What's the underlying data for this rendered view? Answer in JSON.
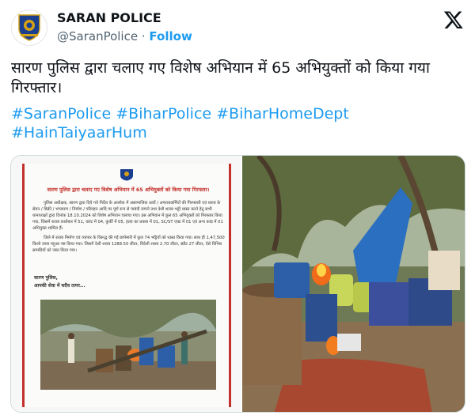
{
  "header": {
    "account_name": "SARAN POLICE",
    "handle": "@SaranPolice",
    "separator": "·",
    "follow_label": "Follow",
    "logo_icon": "x-logo-icon",
    "avatar_icon": "bihar-police-emblem-icon"
  },
  "tweet": {
    "text": "सारण पुलिस द्वारा चलाए गए विशेष अभियान में 65 अभियुक्तों को किया गया गिरफ्तार।",
    "hashtags_line1": "#SaranPolice #BiharPolice #BiharHomeDept",
    "hashtags_line2": "#HainTaiyaarHum"
  },
  "media": {
    "document": {
      "title": "सारण पुलिस द्वारा चलाए गए विशेष अभियान में 65 अभियुक्तों को किया गया गिरफ्तार।",
      "paragraph1": "पुलिस अधीक्षक, सारण द्वारा दिये गये निर्देश के आलोक में असामाजिक तत्वों / अपराधकर्मियों की गिरफ्तारी एवं शराब के सेवन / बिक्री / भण्डारण / निर्माण / परिवहन आदि पर पूर्ण रूप से पाबंदी लगाने तथा देशी शराब भट्ठी ध्वस्त करने हेतु सभी थानाध्यक्षों द्वारा दिनांक 18.10.2024 को विशेष अभियान चलाया गया। इस अभियान में कुल 65 अभियुक्तों को गिरफ्तार किया गया, जिसमें शराब कारोबार में 51, वारंट में 04, कुर्की में 05, हत्या का प्रयास में 01, SC/ST एक्ट में 01 एवं अन्य कांड में 01 अभियुक्त शामिल हैं।",
      "paragraph2": "जिले में शराब निर्माण एवं व्यापार के विरूद्ध की गई छापेमारी में कुल 74 भट्टियों को ध्वस्त किया गया। साथ ही 1,47,500 किलो जावा महुआ नष्ट किया गया। जिसमें देशी शराब 1288.50 लीटर, विदेशी शराब 2.70 लीटर, स्प्रीट 27 लीटर, ऐसे विभिन्न सामग्रियों को जब्त किया गया।",
      "signature_line1": "सारण पुलिस,",
      "signature_line2": "आपकी सेवा में सदैव तत्पर..."
    }
  },
  "colors": {
    "accent": "#1d9bf0",
    "text": "#0f1419",
    "muted": "#536471",
    "doc_red": "#c4302b"
  }
}
